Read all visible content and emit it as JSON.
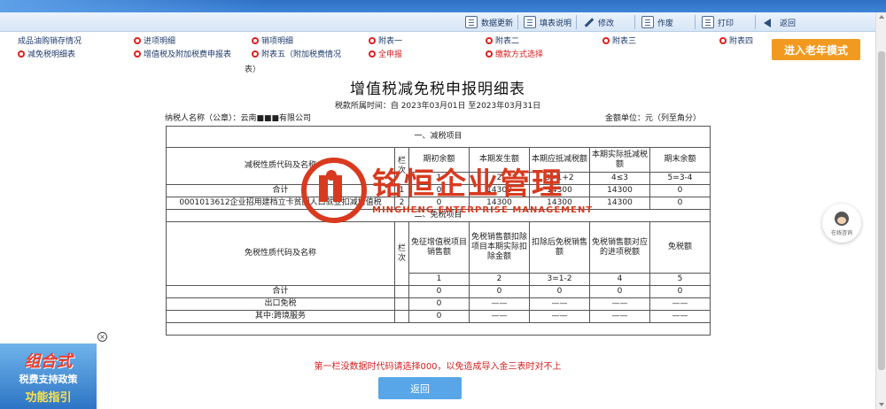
{
  "toolbar": {
    "items": [
      {
        "label": "数据更新",
        "icon": "update-icon"
      },
      {
        "label": "填表说明",
        "icon": "document-icon"
      },
      {
        "label": "修改",
        "icon": "edit-icon"
      },
      {
        "label": "作废",
        "icon": "delete-icon"
      },
      {
        "label": "打印",
        "icon": "print-icon"
      },
      {
        "label": "返回",
        "icon": "back-arrow-icon"
      }
    ]
  },
  "nav": {
    "row1": [
      "成品油购销存情况",
      "进项明细",
      "销项明细",
      "附表一",
      "附表二",
      "附表三",
      "附表四"
    ],
    "row2": [
      "减免税明细表",
      "增值税及附加税费申报表",
      "附表五（附加税费情况",
      "全申报",
      "缴款方式选择"
    ]
  },
  "old_mode_label": "进入老年模式",
  "stub_text": "表）",
  "form": {
    "title": "增值税减免税申报明细表",
    "period": "税款所属时间：自 2023年03月01日 至2023年03月31日",
    "taxpayer": "纳税人名称（公章）：云南■■■有限公司",
    "unit": "金额单位：元（列至角分）"
  },
  "table": {
    "sec1_title": "一、减税项目",
    "sec1_header": {
      "name": "减税性质代码及名称",
      "col": "栏次",
      "c1": "期初余额",
      "c2": "本期发生额",
      "c3": "本期应抵减税额",
      "c4": "本期实际抵减税额",
      "c5": "期末余额"
    },
    "sec1_formula": {
      "c1": "1",
      "c2": "2",
      "c3": "3=1+2",
      "c4": "4≤3",
      "c5": "5=3-4"
    },
    "sec1_rows": [
      {
        "name": "合计",
        "col": "1",
        "c1": "0",
        "c2": "14300",
        "c3": "14300",
        "c4": "14300",
        "c5": "0"
      },
      {
        "name": "0001013612企业招用建档立卡贫困人口就业扣减增值税",
        "col": "2",
        "c1": "0",
        "c2": "14300",
        "c3": "14300",
        "c4": "14300",
        "c5": "0"
      }
    ],
    "sec2_title": "二、免税项目",
    "sec2_header": {
      "name": "免税性质代码及名称",
      "col": "栏次",
      "c1": "免征增值税项目销售额",
      "c2": "免税销售额扣除项目本期实际扣除金额",
      "c3": "扣除后免税销售额",
      "c4": "免税销售额对应的进项税额",
      "c5": "免税额"
    },
    "sec2_formula": {
      "c1": "1",
      "c2": "2",
      "c3": "3=1-2",
      "c4": "4",
      "c5": "5"
    },
    "sec2_rows": [
      {
        "name": "合计",
        "col": "",
        "c1": "0",
        "c2": "0",
        "c3": "0",
        "c4": "0",
        "c5": "0"
      },
      {
        "name": "出口免税",
        "col": "",
        "c1": "0",
        "c2": "——",
        "c3": "——",
        "c4": "——",
        "c5": "——"
      },
      {
        "name": "其中:跨境服务",
        "col": "",
        "c1": "0",
        "c2": "——",
        "c3": "——",
        "c4": "——",
        "c5": "——"
      }
    ]
  },
  "watermark": {
    "name": "铭恒企业管理",
    "english": "MINGHENG ENTERPRISE MANAGEMENT"
  },
  "consult_label": "在线咨询",
  "ad": {
    "line1": "组合式",
    "line2": "税费支持政策",
    "line3": "功能指引"
  },
  "notice": "第一栏没数据时代码请选择000，以免造成导入金三表时对不上",
  "return_button": "返回",
  "colors": {
    "accent": "#3d84d6",
    "orange": "#f29a1f",
    "red": "#d61f1f",
    "watermark": "#d83a1f"
  }
}
